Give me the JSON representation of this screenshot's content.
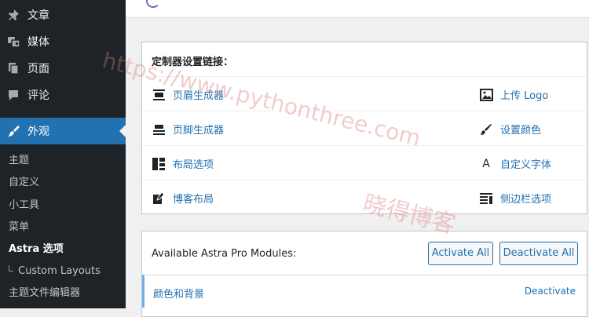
{
  "sidebar": {
    "menu": [
      {
        "label": "文章",
        "icon": "pushpin-icon"
      },
      {
        "label": "媒体",
        "icon": "media-icon"
      },
      {
        "label": "页面",
        "icon": "pages-icon"
      },
      {
        "label": "评论",
        "icon": "comments-icon"
      },
      {
        "label": "外观",
        "icon": "appearance-icon",
        "active": true
      }
    ],
    "submenu": [
      {
        "label": "主题"
      },
      {
        "label": "自定义"
      },
      {
        "label": "小工具"
      },
      {
        "label": "菜单"
      },
      {
        "label": "Astra 选项",
        "current": true
      },
      {
        "label": "Custom Layouts",
        "nested": true
      },
      {
        "label": "主题文件编辑器"
      }
    ]
  },
  "customizer": {
    "title": "定制器设置链接：",
    "links": [
      {
        "label": "页眉生成器",
        "icon": "header-builder-icon"
      },
      {
        "label": "上传 Logo",
        "icon": "image-upload-icon"
      },
      {
        "label": "页脚生成器",
        "icon": "footer-builder-icon"
      },
      {
        "label": "设置颜色",
        "icon": "paintbrush-icon"
      },
      {
        "label": "布局选项",
        "icon": "layout-icon"
      },
      {
        "label": "自定义字体",
        "icon": "typography-icon"
      },
      {
        "label": "博客布局",
        "icon": "edit-icon"
      },
      {
        "label": "侧边栏选项",
        "icon": "sidebar-icon"
      }
    ]
  },
  "modules": {
    "title": "Available Astra Pro Modules:",
    "activate_all": "Activate All",
    "deactivate_all": "Deactivate All",
    "items": [
      {
        "name": "颜色和背景",
        "action": "Deactivate"
      }
    ]
  },
  "watermarks": [
    "https://www.pythonthree.com",
    "晓得博客"
  ],
  "colors": {
    "sidebar_bg": "#1d2327",
    "accent": "#2271b1",
    "page_bg": "#f0f0f1",
    "watermark": "#de7878"
  }
}
